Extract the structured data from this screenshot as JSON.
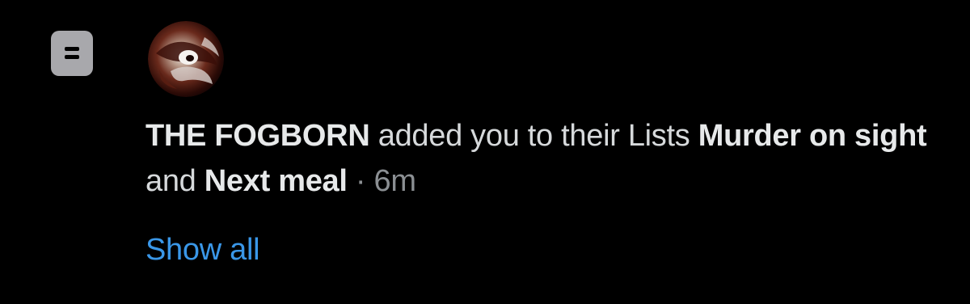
{
  "notification": {
    "icon": "list-icon",
    "avatar": "avatar",
    "actor_name": "THE FOGBORN",
    "action_text": "added you to their Lists",
    "list_one": "Murder on sight",
    "conjunction": "and",
    "list_two": "Next meal",
    "separator": "·",
    "timestamp": "6m",
    "show_all_label": "Show all"
  },
  "colors": {
    "background": "#000000",
    "primary_text": "#e7e9ea",
    "secondary_text": "#8b8f93",
    "link": "#3a97e8",
    "icon_bg": "#a8a8ac"
  }
}
